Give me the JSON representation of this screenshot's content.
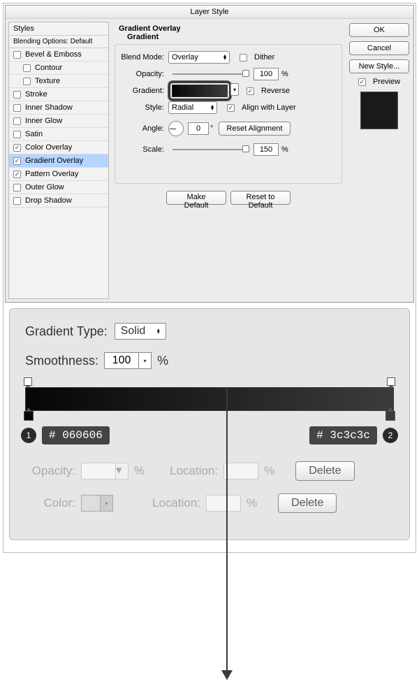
{
  "dialog": {
    "title": "Layer Style"
  },
  "stylesPanel": {
    "header": "Styles",
    "blending": "Blending Options: Default",
    "items": [
      {
        "label": "Bevel & Emboss",
        "checked": false,
        "indent": false,
        "selected": false
      },
      {
        "label": "Contour",
        "checked": false,
        "indent": true,
        "selected": false
      },
      {
        "label": "Texture",
        "checked": false,
        "indent": true,
        "selected": false
      },
      {
        "label": "Stroke",
        "checked": false,
        "indent": false,
        "selected": false
      },
      {
        "label": "Inner Shadow",
        "checked": false,
        "indent": false,
        "selected": false
      },
      {
        "label": "Inner Glow",
        "checked": false,
        "indent": false,
        "selected": false
      },
      {
        "label": "Satin",
        "checked": false,
        "indent": false,
        "selected": false
      },
      {
        "label": "Color Overlay",
        "checked": true,
        "indent": false,
        "selected": false
      },
      {
        "label": "Gradient Overlay",
        "checked": true,
        "indent": false,
        "selected": true
      },
      {
        "label": "Pattern Overlay",
        "checked": true,
        "indent": false,
        "selected": false
      },
      {
        "label": "Outer Glow",
        "checked": false,
        "indent": false,
        "selected": false
      },
      {
        "label": "Drop Shadow",
        "checked": false,
        "indent": false,
        "selected": false
      }
    ]
  },
  "center": {
    "sectionTitle": "Gradient Overlay",
    "sectionSub": "Gradient",
    "blendModeLabel": "Blend Mode:",
    "blendModeValue": "Overlay",
    "ditherLabel": "Dither",
    "ditherChecked": false,
    "opacityLabel": "Opacity:",
    "opacityValue": "100",
    "pct": "%",
    "gradientLabel": "Gradient:",
    "reverseLabel": "Reverse",
    "reverseChecked": true,
    "styleLabel": "Style:",
    "styleValue": "Radial",
    "alignLabel": "Align with Layer",
    "alignChecked": true,
    "angleLabel": "Angle:",
    "angleValue": "0",
    "deg": "°",
    "resetAlignLabel": "Reset Alignment",
    "scaleLabel": "Scale:",
    "scaleValue": "150",
    "makeDefault": "Make Default",
    "resetDefault": "Reset to Default"
  },
  "right": {
    "ok": "OK",
    "cancel": "Cancel",
    "newStyle": "New Style...",
    "previewLabel": "Preview",
    "previewChecked": true
  },
  "editor": {
    "gradTypeLabel": "Gradient Type:",
    "gradTypeValue": "Solid",
    "smoothLabel": "Smoothness:",
    "smoothValue": "100",
    "pct": "%",
    "stop1Num": "1",
    "stop1Hex": "# 060606",
    "stop2Num": "2",
    "stop2Hex": "# 3c3c3c",
    "opacityLabel": "Opacity:",
    "locationLabel": "Location:",
    "colorLabel": "Color:",
    "deleteLabel": "Delete"
  }
}
